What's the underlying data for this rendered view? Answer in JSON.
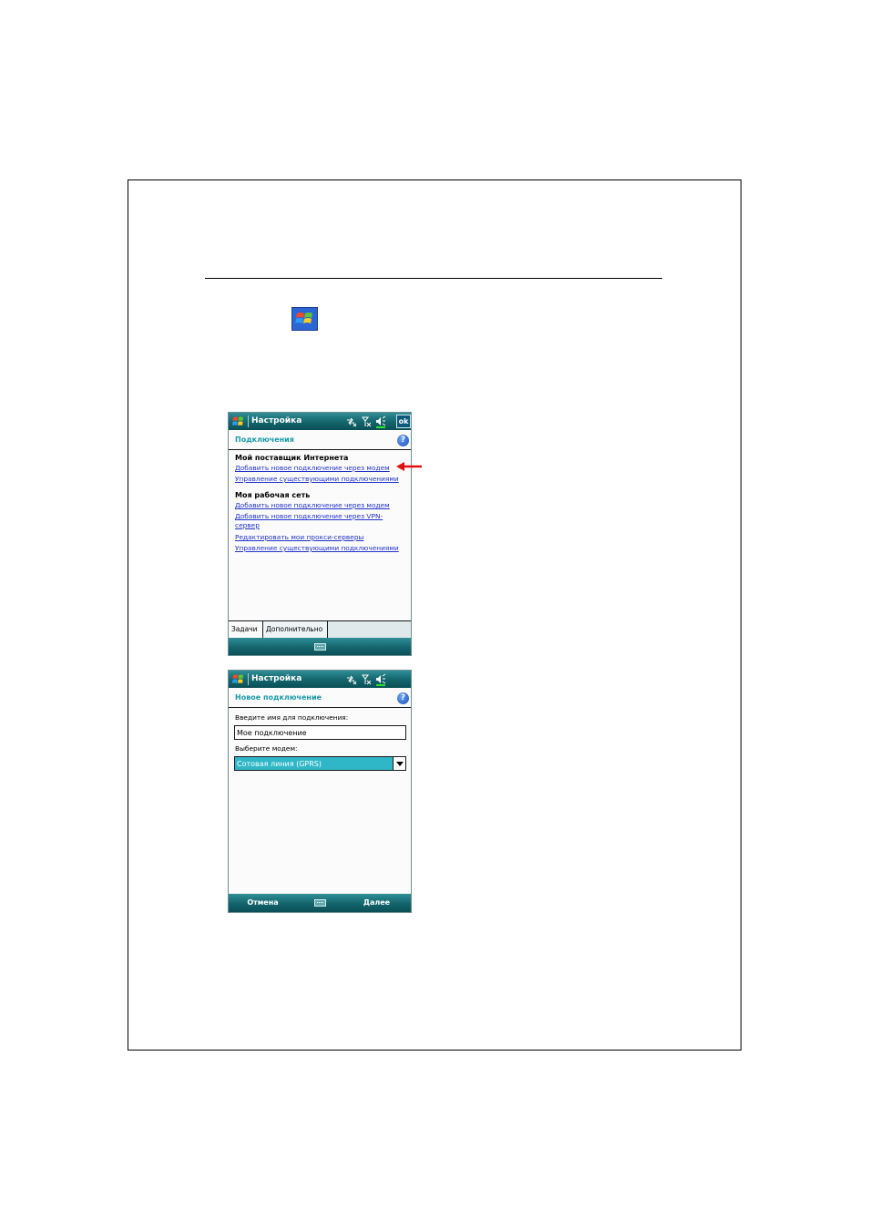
{
  "screen1": {
    "title": "Настройка",
    "ok_label": "ok",
    "header_title": "Подключения",
    "help_icon": "?",
    "sections": [
      {
        "heading": "Мой поставщик Интернета",
        "links": [
          "Добавить новое подключение через модем",
          "Управление существующими подключениями"
        ]
      },
      {
        "heading": "Моя рабочая сеть",
        "links": [
          "Добавить новое подключение через модем",
          "Добавить новое подключение через VPN-",
          "сервер",
          "Редактировать мои прокси-серверы",
          "Управление существующими подключениями"
        ]
      }
    ],
    "tabs": [
      "Задачи",
      "Дополнительно"
    ]
  },
  "screen2": {
    "title": "Настройка",
    "header_title": "Новое подключение",
    "help_icon": "?",
    "name_label": "Введите имя для подключения:",
    "name_value": "Мое подключение",
    "modem_label": "Выберите модем:",
    "modem_value": "Сотовая линия (GPRS)",
    "soft_left": "Отмена",
    "soft_right": "Далее"
  },
  "colors": {
    "titlebar": "#13646b",
    "header_text": "#1b9aa8",
    "link": "#2233cc",
    "selection": "#30b7c7",
    "arrow": "#e01010"
  }
}
